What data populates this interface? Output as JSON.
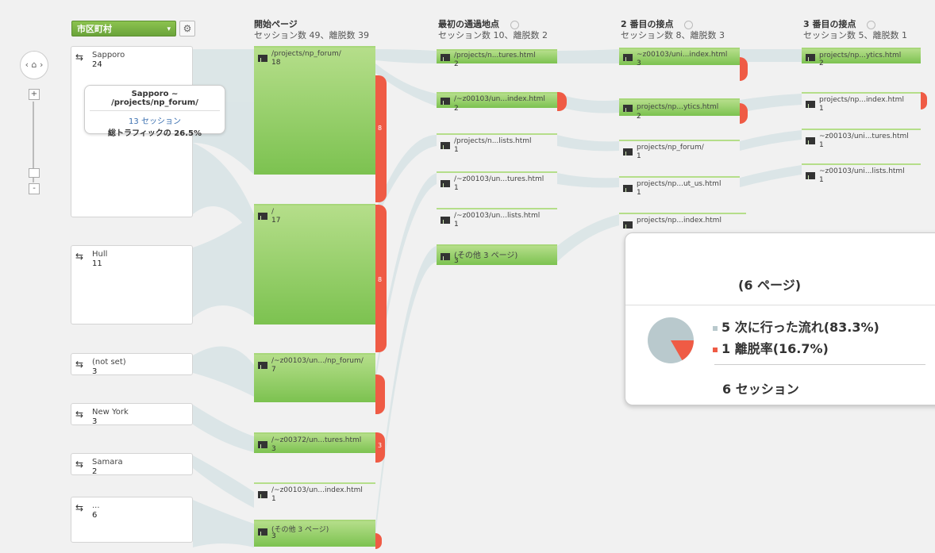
{
  "dimension_selector": {
    "label": "市区町村"
  },
  "columns": [
    {
      "title": "開始ページ",
      "subtitle": "セッション数 49、離脱数 39"
    },
    {
      "title": "最初の通過地点",
      "subtitle": "セッション数 10、離脱数 2"
    },
    {
      "title": "2 番目の接点",
      "subtitle": "セッション数 8、離脱数 3"
    },
    {
      "title": "3 番目の接点",
      "subtitle": "セッション数 5、離脱数 1"
    }
  ],
  "sources": [
    {
      "name": "Sapporo",
      "count": "24"
    },
    {
      "name": "Hull",
      "count": "11"
    },
    {
      "name": "(not set)",
      "count": "3"
    },
    {
      "name": "New York",
      "count": "3"
    },
    {
      "name": "Samara",
      "count": "2"
    },
    {
      "name": "...",
      "count": "6"
    }
  ],
  "tooltip": {
    "title": "Sapporo ~ /projects/np_forum/",
    "sessions": "13 セッション",
    "percent": "総トラフィックの 26.5%"
  },
  "start_pages": [
    {
      "name": "/projects/np_forum/",
      "count": "18",
      "drop": "8"
    },
    {
      "name": "/",
      "count": "17",
      "drop": "8"
    },
    {
      "name": "/~z00103/un.../np_forum/",
      "count": "7",
      "drop": ""
    },
    {
      "name": "/~z00372/un...tures.html",
      "count": "3",
      "drop": "3"
    },
    {
      "name": "/~z00103/un...index.html",
      "count": "1",
      "drop": ""
    },
    {
      "name": "(その他 3 ページ)",
      "count": "3",
      "drop": ""
    }
  ],
  "first_interaction": [
    {
      "name": "/projects/n...tures.html",
      "count": "2"
    },
    {
      "name": "/~z00103/un...index.html",
      "count": "2"
    },
    {
      "name": "/projects/n...lists.html",
      "count": "1"
    },
    {
      "name": "/~z00103/un...tures.html",
      "count": "1"
    },
    {
      "name": "/~z00103/un...lists.html",
      "count": "1"
    },
    {
      "name": "(その他 3 ページ)",
      "count": "3"
    }
  ],
  "second_interaction": [
    {
      "name": "~z00103/uni...index.html",
      "count": "3"
    },
    {
      "name": "projects/np...ytics.html",
      "count": "2"
    },
    {
      "name": "projects/np_forum/",
      "count": "1"
    },
    {
      "name": "projects/np...ut_us.html",
      "count": "1"
    },
    {
      "name": "projects/np...index.html",
      "count": ""
    }
  ],
  "third_interaction": [
    {
      "name": "projects/np...ytics.html",
      "count": "2"
    },
    {
      "name": "projects/np...index.html",
      "count": "1"
    },
    {
      "name": "~z00103/uni...tures.html",
      "count": "1"
    },
    {
      "name": "~z00103/uni...lists.html",
      "count": "1"
    }
  ],
  "popup": {
    "title": "(6 ページ)",
    "flow_label": "5 次に行った流れ(83.3%)",
    "drop_label": "1 離脱率(16.7%)",
    "sessions": "6 セッション",
    "pie_fractions": {
      "flow": 0.833,
      "drop": 0.167
    }
  },
  "colors": {
    "node_green": "#7cc250",
    "drop_red": "#ef5b45",
    "flow": "#d6e2e4",
    "link_blue": "#3a6fb0"
  },
  "icons": [
    "home-icon",
    "gear-icon",
    "zoom-in-icon",
    "zoom-out-icon",
    "traffic-source-icon",
    "page-icon"
  ]
}
